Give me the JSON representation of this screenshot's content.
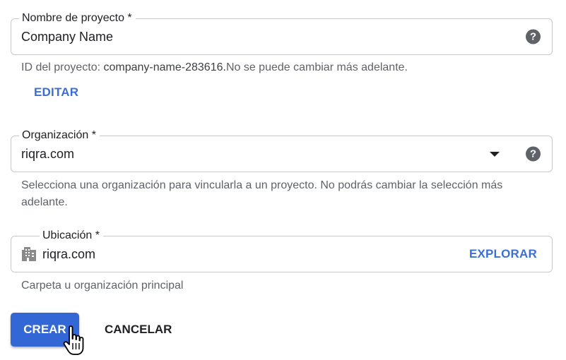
{
  "project_name": {
    "label": "Nombre de proyecto *",
    "value": "Company Name",
    "help_icon": "help-icon"
  },
  "project_id": {
    "prefix": "ID del proyecto: ",
    "id_text": "company-name-283616.",
    "suffix": "No se puede cambiar más adelante."
  },
  "edit_button": "EDITAR",
  "organization": {
    "label": "Organización *",
    "value": "riqra.com",
    "helper": "Selecciona una organización para vincularla a un proyecto. No podrás cambiar la selección más adelante.",
    "dropdown_icon": "dropdown-arrow-icon",
    "help_icon": "help-icon"
  },
  "location": {
    "label": "Ubicación *",
    "value": "riqra.com",
    "browse_label": "EXPLORAR",
    "helper": "Carpeta u organización principal",
    "icon": "building-icon"
  },
  "actions": {
    "create_label": "CREAR",
    "cancel_label": "CANCELAR"
  },
  "colors": {
    "accent": "#3367d6",
    "link": "#3c6fd6",
    "helper_text": "#5f6368",
    "border": "#c8c8c8"
  }
}
